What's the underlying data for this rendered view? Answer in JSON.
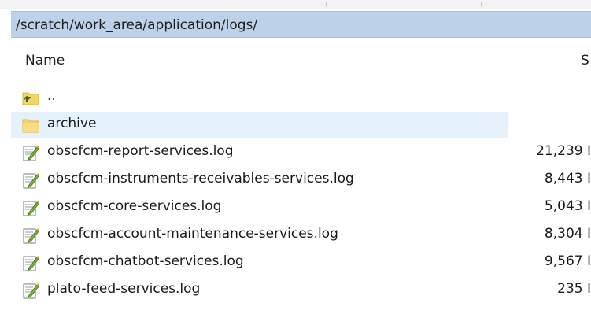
{
  "path_bar": {
    "path": "/scratch/work_area/application/logs/"
  },
  "columns": {
    "name": "Name",
    "size": "S"
  },
  "rows": [
    {
      "name": "..",
      "size": "",
      "icon": "parent-folder-icon"
    },
    {
      "name": "archive",
      "size": "",
      "icon": "folder-icon",
      "selected": true
    },
    {
      "name": "obscfcm-report-services.log",
      "size": "21,239 I",
      "icon": "log-file-icon"
    },
    {
      "name": "obscfcm-instruments-receivables-services.log",
      "size": "8,443 I",
      "icon": "log-file-icon"
    },
    {
      "name": "obscfcm-core-services.log",
      "size": "5,043 I",
      "icon": "log-file-icon"
    },
    {
      "name": "obscfcm-account-maintenance-services.log",
      "size": "8,304 I",
      "icon": "log-file-icon"
    },
    {
      "name": "obscfcm-chatbot-services.log",
      "size": "9,567 I",
      "icon": "log-file-icon"
    },
    {
      "name": "plato-feed-services.log",
      "size": "235 I",
      "icon": "log-file-icon"
    }
  ],
  "colors": {
    "path_bar_bg": "#bcd2e8",
    "selected_row_bg": "#e5f1fb",
    "folder_yellow": "#f5d46a"
  }
}
